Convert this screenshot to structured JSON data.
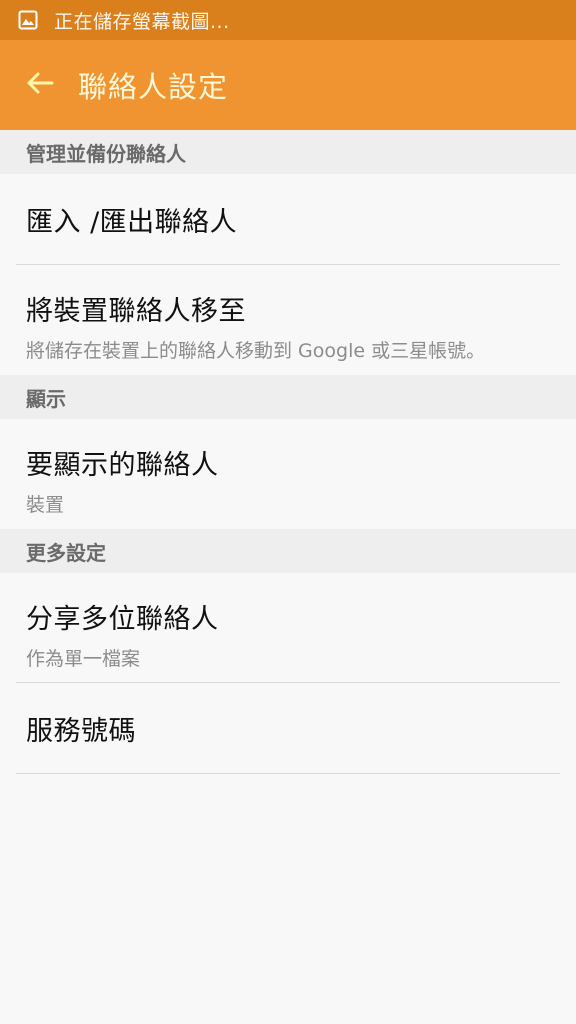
{
  "status_bar": {
    "icon": "image-icon",
    "text": "正在儲存螢幕截圖..."
  },
  "app_bar": {
    "back_icon": "arrow-left-icon",
    "title": "聯絡人設定"
  },
  "sections": [
    {
      "header": "管理並備份聯絡人",
      "items": [
        {
          "title": "匯入 /匯出聯絡人"
        },
        {
          "title": "將裝置聯絡人移至",
          "subtitle": "將儲存在裝置上的聯絡人移動到 Google 或三星帳號。"
        }
      ]
    },
    {
      "header": "顯示",
      "items": [
        {
          "title": "要顯示的聯絡人",
          "subtitle": "裝置"
        }
      ]
    },
    {
      "header": "更多設定",
      "items": [
        {
          "title": "分享多位聯絡人",
          "subtitle": "作為單一檔案"
        },
        {
          "title": "服務號碼"
        }
      ]
    }
  ],
  "colors": {
    "status_bar": "#d97f1c",
    "app_bar": "#f09431",
    "title_text": "#fff7d6"
  }
}
